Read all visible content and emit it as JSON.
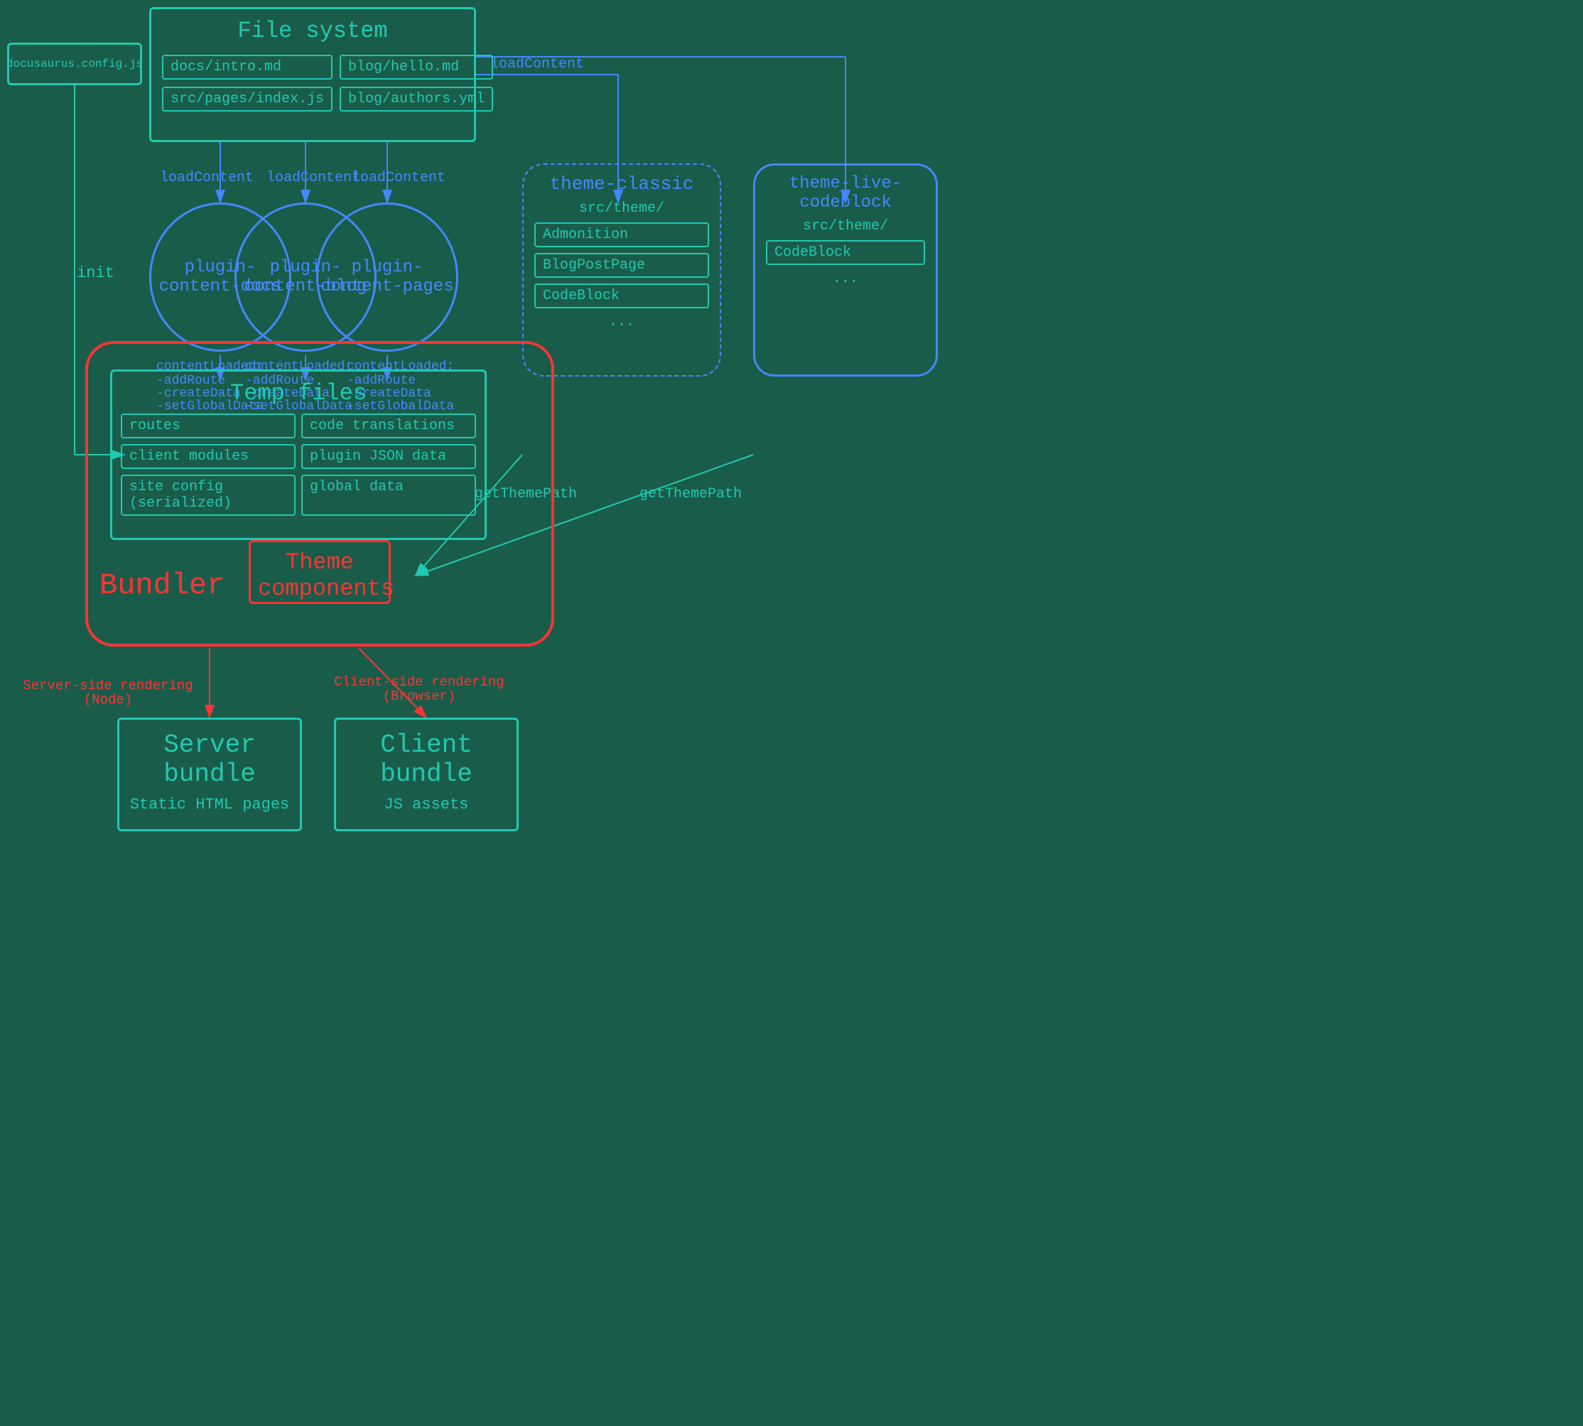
{
  "background": "#1a5c4a",
  "colors": {
    "teal": "#20c9b0",
    "blue": "#4488ff",
    "red": "#ff3333"
  },
  "fileSystem": {
    "title": "File system",
    "files": [
      "docs/intro.md",
      "blog/hello.md",
      "src/pages/index.js",
      "blog/authors.yml"
    ]
  },
  "docusaurusConfig": {
    "label": "docusaurus.config.js"
  },
  "plugins": [
    {
      "name": "plugin-content-docs",
      "contentLoaded": "contentLoaded:\n-addRoute\n-createData\n-setGlobalData"
    },
    {
      "name": "plugin-content-blog",
      "contentLoaded": "contentLoaded:\n-addRoute\n-createData\n-setGlobalData"
    },
    {
      "name": "plugin-content-pages",
      "contentLoaded": "contentLoaded:\n-addRoute\n-createData\n-setGlobalData"
    }
  ],
  "themeClassic": {
    "title": "theme-classic",
    "srcTheme": "src/theme/",
    "components": [
      "Admonition",
      "BlogPostPage",
      "CodeBlock",
      "..."
    ]
  },
  "themeLiveCodeblock": {
    "title": "theme-live-codeblock",
    "srcTheme": "src/theme/",
    "components": [
      "CodeBlock",
      "..."
    ]
  },
  "tempFiles": {
    "title": "Temp files",
    "items": [
      "routes",
      "code translations",
      "client modules",
      "plugin JSON data",
      "site config (serialized)",
      "global data"
    ]
  },
  "bundler": {
    "label": "Bundler"
  },
  "themeComponents": {
    "label": "Theme components"
  },
  "serverBundle": {
    "title": "Server bundle",
    "subtitle": "Static HTML pages"
  },
  "clientBundle": {
    "title": "Client bundle",
    "subtitle": "JS assets"
  },
  "arrows": {
    "init": "init",
    "loadContent": "loadContent",
    "contentLoaded1": "contentLoaded:\n-addRoute\n-createData\n-setGlobalData",
    "getThemePath": "getThemePath",
    "serverSideRendering": "Server-side rendering\n(Node)",
    "clientSideRendering": "Client-side rendering\n(Browser)"
  }
}
